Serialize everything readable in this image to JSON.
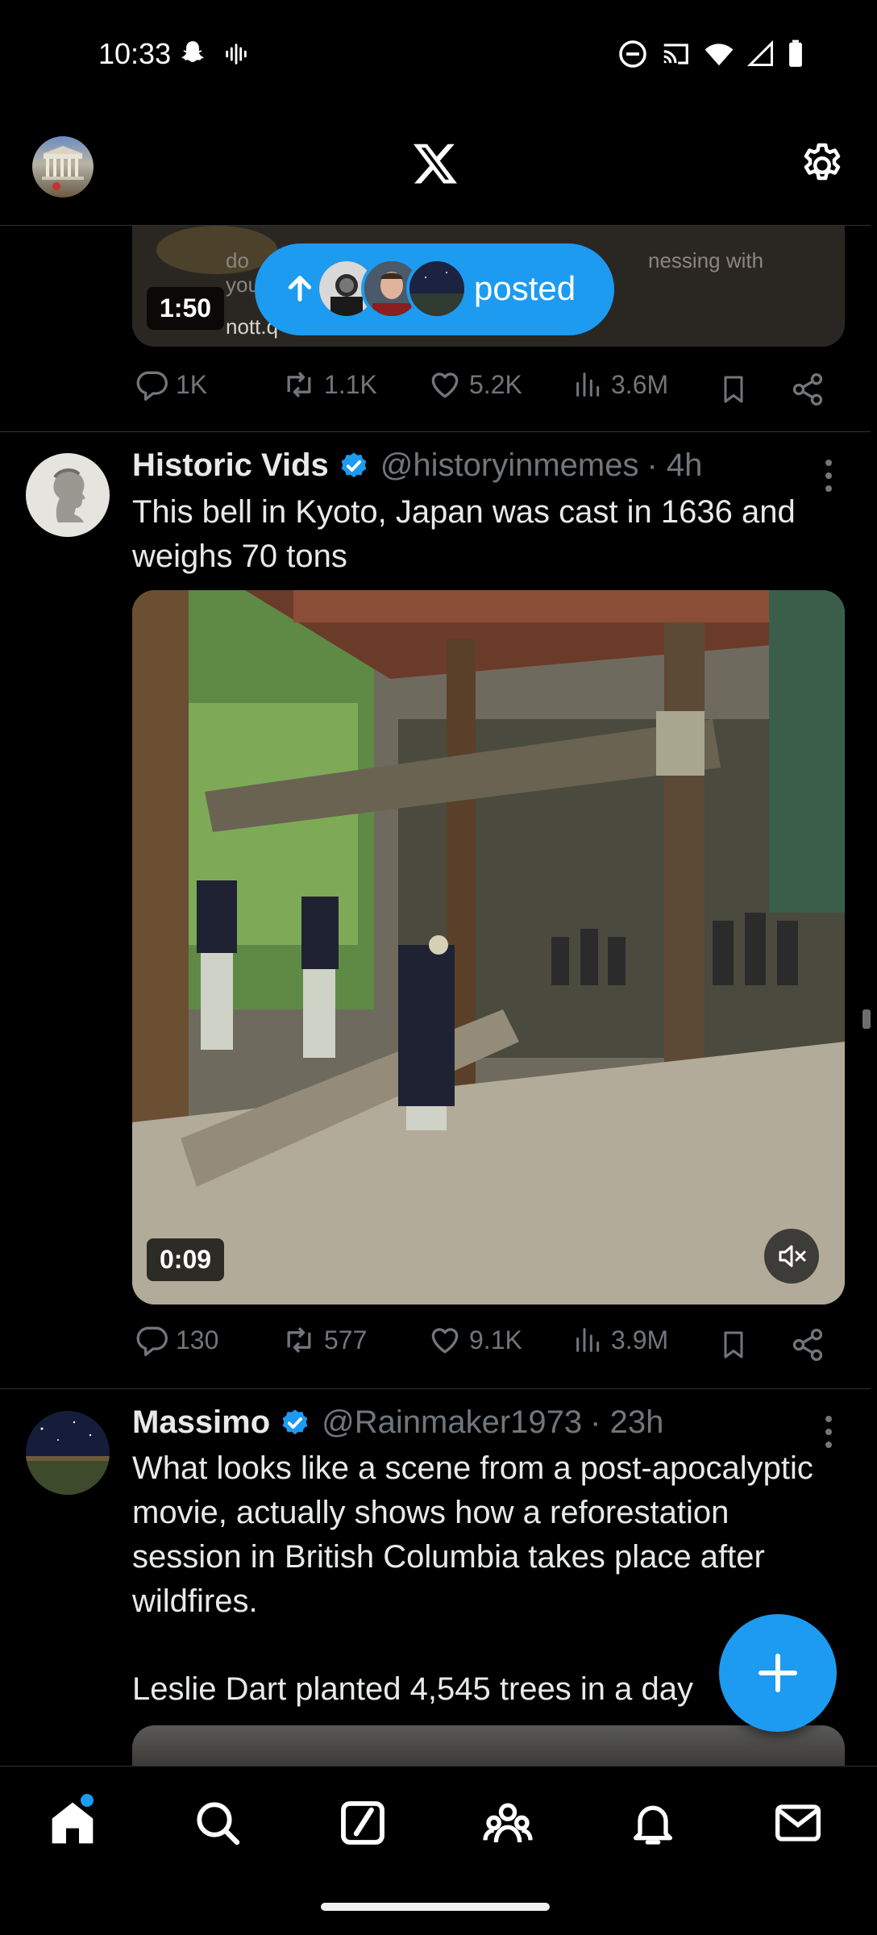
{
  "status_bar": {
    "time": "10:33",
    "icons_left": [
      "snapchat-icon",
      "voice-waveform-icon"
    ],
    "icons_right": [
      "do-not-disturb-icon",
      "cast-icon",
      "wifi-icon",
      "signal-icon",
      "battery-icon"
    ]
  },
  "header": {
    "logo": "X",
    "icons": [
      "profile-avatar",
      "x-logo-icon",
      "settings-icon"
    ]
  },
  "top_tweet": {
    "duration": "1:50",
    "overlay_text": [
      "do",
      "you",
      "nott.q",
      "nessing with"
    ],
    "new_posts_pill": {
      "label": "posted"
    },
    "stats": {
      "replies": "1K",
      "reposts": "1.1K",
      "likes": "5.2K",
      "views": "3.6M"
    }
  },
  "tweet_1": {
    "name": "Historic Vids",
    "handle": "@historyinmemes",
    "time": "· 4h",
    "text": "This bell in Kyoto, Japan was cast in 1636 and weighs 70 tons",
    "video_duration": "0:09",
    "stats": {
      "replies": "130",
      "reposts": "577",
      "likes": "9.1K",
      "views": "3.9M"
    }
  },
  "tweet_2": {
    "name": "Massimo",
    "handle": "@Rainmaker1973",
    "time": "· 23h",
    "text": "What looks like a scene from a post-apocalyptic movie, actually shows how a reforestation session in British Columbia takes place after wildfires.",
    "text_2": "Leslie Dart planted 4,545 trees in a day"
  },
  "bottom_nav": {
    "items": [
      "home-icon",
      "search-icon",
      "grok-icon",
      "communities-icon",
      "notifications-icon",
      "messages-icon"
    ],
    "active": "home-icon"
  },
  "colors": {
    "accent": "#1d9bf0",
    "background": "#000000",
    "muted": "#71767b",
    "text": "#e7e9ea"
  }
}
